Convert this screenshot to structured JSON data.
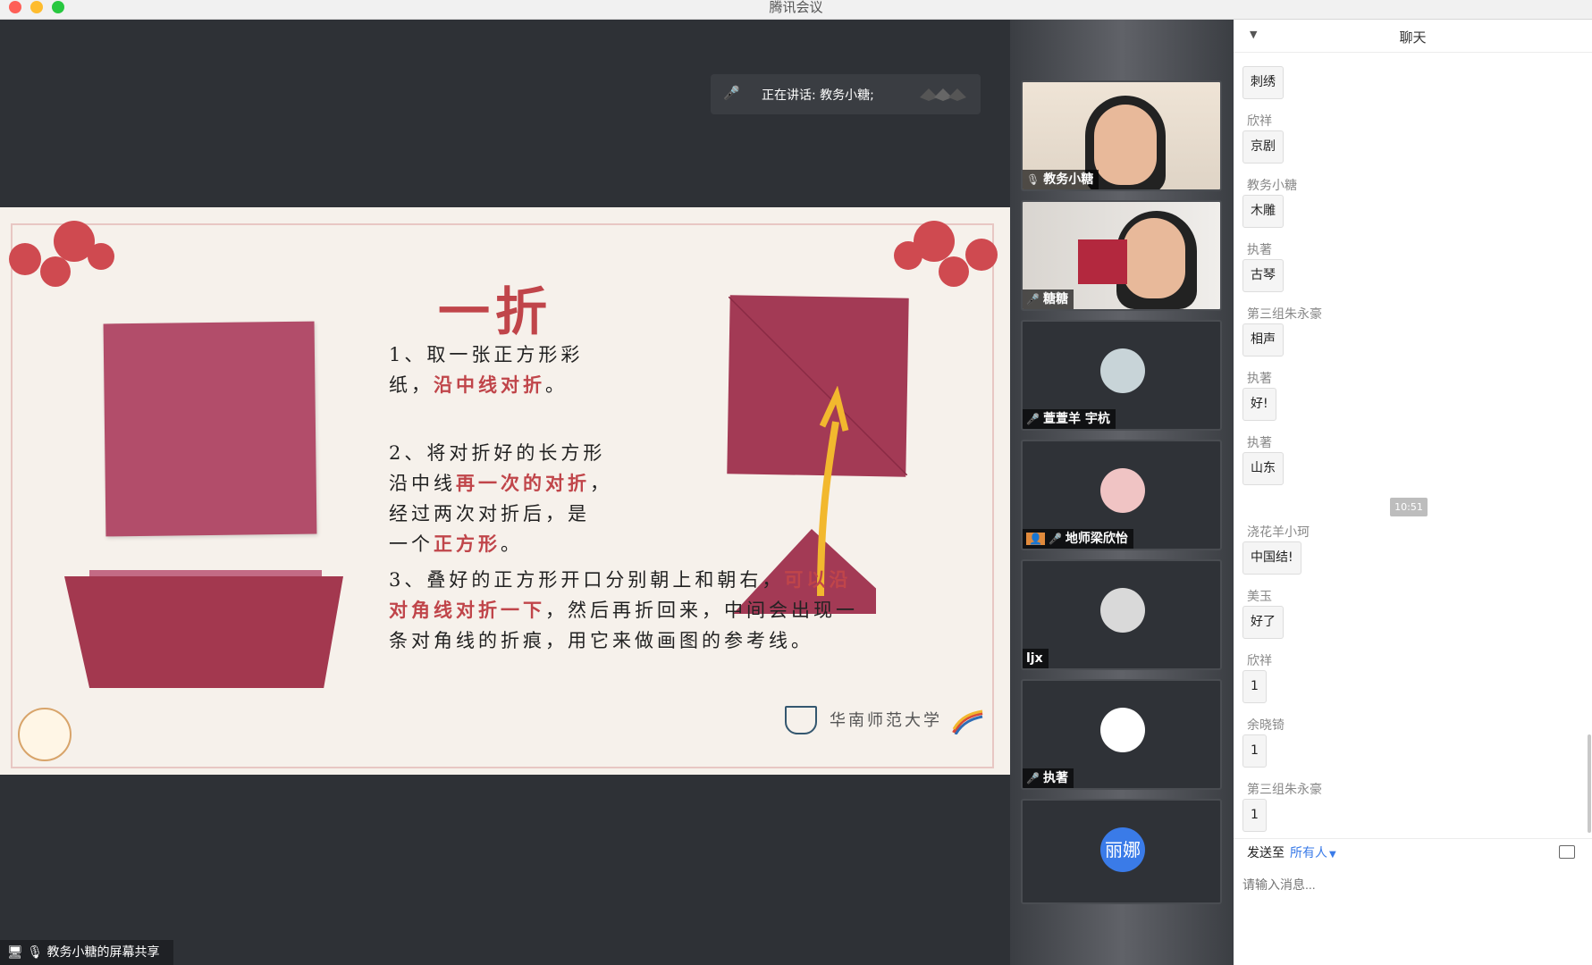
{
  "window": {
    "title": "腾讯会议"
  },
  "speaking": {
    "label": "正在讲话: 教务小糖;"
  },
  "slide": {
    "title": "一折",
    "step1_a": "1、取一张正方形彩",
    "step1_b": "纸，",
    "step1_red": "沿中线对折",
    "step1_c": "。",
    "step2_a": "2、将对折好的长方形",
    "step2_b": "沿中线",
    "step2_red": "再一次的对折",
    "step2_c": "，",
    "step2_d": "经过两次对折后，是",
    "step2_e": "一个",
    "step2_red2": "正方形",
    "step2_f": "。",
    "step3_a": "3、叠好的正方形开口分别朝上和朝右，",
    "step3_red": "可以沿",
    "step3_red2": "对角线对折一下",
    "step3_b": "，然后再折回来，中间会出现一",
    "step3_c": "条对角线的折痕，用它来做画图的参考线。",
    "school": "华南师范大学"
  },
  "participants": [
    {
      "name": "教务小糖",
      "mic": "on"
    },
    {
      "name": "糖糖",
      "mic": "muted"
    },
    {
      "name": "萱萱羊 宇杭",
      "mic": "muted"
    },
    {
      "name": "地师梁欣怡",
      "mic": "muted"
    },
    {
      "name": "ljx",
      "mic": "none"
    },
    {
      "name": "执著",
      "mic": "muted"
    },
    {
      "name": "丽娜",
      "avatar_text": "丽娜",
      "avatar_color": "#3a7be8"
    }
  ],
  "chat": {
    "title": "聊天",
    "messages": [
      {
        "sender": "",
        "text": "刺绣"
      },
      {
        "sender": "欣祥",
        "text": "京剧"
      },
      {
        "sender": "教务小糖",
        "text": "木雕"
      },
      {
        "sender": "执著",
        "text": "古琴"
      },
      {
        "sender": "第三组朱永豪",
        "text": "相声"
      },
      {
        "sender": "执著",
        "text": "好!"
      },
      {
        "sender": "执著",
        "text": "山东"
      },
      {
        "sender": "浇花羊小珂",
        "text": "中国结!"
      },
      {
        "sender": "美玉",
        "text": "好了"
      },
      {
        "sender": "欣祥",
        "text": "1"
      },
      {
        "sender": "余晓锜",
        "text": "1"
      },
      {
        "sender": "第三组朱永豪",
        "text": "1"
      }
    ],
    "time_chip": "10:51",
    "send_to_label": "发送至",
    "send_to_target": "所有人",
    "input_placeholder": "请输入消息..."
  },
  "share_badge": "教务小糖的屏幕共享"
}
